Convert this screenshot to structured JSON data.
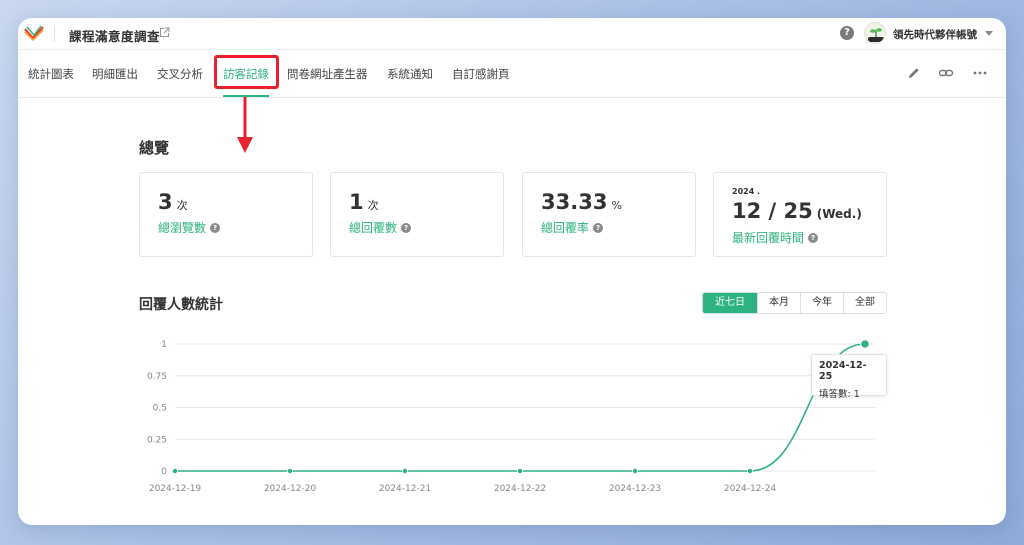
{
  "header": {
    "title": "課程滿意度調查",
    "account_name": "領先時代夥伴帳號",
    "help_label": "?"
  },
  "tabs": [
    {
      "label": "統計圖表",
      "active": false
    },
    {
      "label": "明細匯出",
      "active": false
    },
    {
      "label": "交叉分析",
      "active": false
    },
    {
      "label": "訪客記錄",
      "active": true
    },
    {
      "label": "問卷網址產生器",
      "active": false
    },
    {
      "label": "系統通知",
      "active": false
    },
    {
      "label": "自訂感謝頁",
      "active": false
    }
  ],
  "toolbar_icons": [
    "pencil-icon",
    "link-icon",
    "more-icon"
  ],
  "overview": {
    "title": "總覽",
    "cards": [
      {
        "value": "3",
        "unit": "次",
        "label": "總瀏覽數"
      },
      {
        "value": "1",
        "unit": "次",
        "label": "總回覆數"
      },
      {
        "value": "33.33",
        "unit": "%",
        "label": "總回覆率"
      }
    ],
    "latest": {
      "year": "2024 .",
      "date": "12 / 25",
      "weekday": "(Wed.)",
      "label": "最新回覆時間"
    }
  },
  "stats": {
    "title": "回覆人數統計",
    "ranges": [
      {
        "label": "近七日",
        "active": true
      },
      {
        "label": "本月",
        "active": false
      },
      {
        "label": "今年",
        "active": false
      },
      {
        "label": "全部",
        "active": false
      }
    ]
  },
  "tooltip": {
    "date": "2024-12-25",
    "line": "填答數: 1"
  },
  "colors": {
    "accent": "#2db37f",
    "highlight": "#e8212f"
  },
  "chart_data": {
    "type": "line",
    "x": [
      "2024-12-19",
      "2024-12-20",
      "2024-12-21",
      "2024-12-22",
      "2024-12-23",
      "2024-12-24",
      "2024-12-25"
    ],
    "x_tick_labels": [
      "2024-12-19",
      "2024-12-20",
      "2024-12-21",
      "2024-12-22",
      "2024-12-23",
      "2024-12-24"
    ],
    "series": [
      {
        "values": [
          0,
          0,
          0,
          0,
          0,
          0,
          1
        ]
      }
    ],
    "y_ticks": [
      "0",
      "0.25",
      "0.5",
      "0.75",
      "1"
    ],
    "ylim": [
      0,
      1
    ],
    "grid": true
  }
}
